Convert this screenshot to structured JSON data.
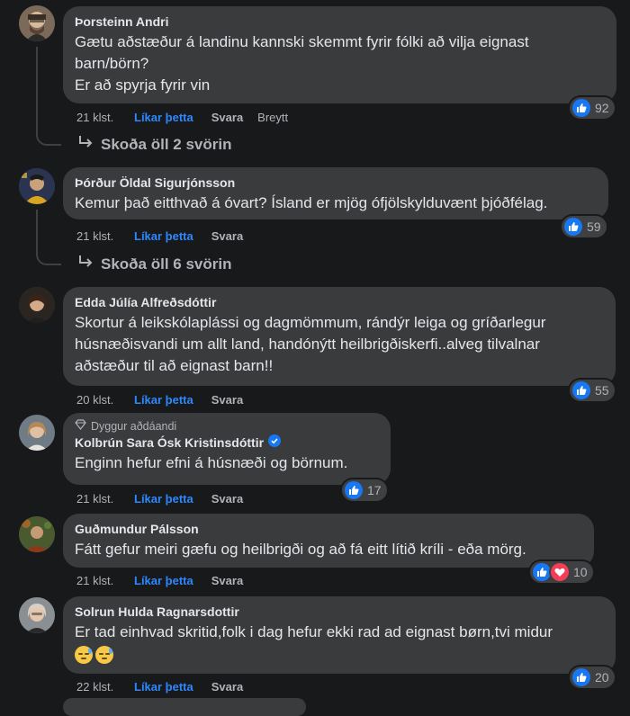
{
  "comments": [
    {
      "author": "Þorsteinn Andri",
      "text": "Gætu aðstæður á landinu kannski skemmt fyrir fólki að vilja eignast barn/börn?\nEr að spyrja fyrir vin",
      "time": "21 klst.",
      "like_label": "Líkar þetta",
      "reply_label": "Svara",
      "edited_label": "Breytt",
      "reaction_count": "92",
      "view_replies": "Skoða öll 2 svörin"
    },
    {
      "author": "Þórður Öldal Sigurjónsson",
      "text": "Kemur það eitthvað á óvart? Ísland er mjög ófjölskylduvænt þjóðfélag.",
      "time": "21 klst.",
      "like_label": "Líkar þetta",
      "reply_label": "Svara",
      "reaction_count": "59",
      "view_replies": "Skoða öll 6 svörin"
    },
    {
      "author": "Edda Júlía Alfreðsdóttir",
      "text": "Skortur á leikskólaplássi og dagmömmum, rándýr leiga og gríðarlegur húsnæðisvandi um allt land, handónýtt heilbrigðiskerfi..alveg tilvalnar aðstæður til að eignast barn!!",
      "time": "20 klst.",
      "like_label": "Líkar þetta",
      "reply_label": "Svara",
      "reaction_count": "55"
    },
    {
      "badge": "Dyggur aðdáandi",
      "author": "Kolbrún Sara Ósk Kristinsdóttir",
      "text": "Enginn hefur efni á húsnæði og börnum.",
      "time": "21 klst.",
      "like_label": "Líkar þetta",
      "reply_label": "Svara",
      "reaction_count": "17"
    },
    {
      "author": "Guðmundur Pálsson",
      "text": "Fátt gefur meiri gæfu og heilbrigði og að fá eitt lítið kríli - eða mörg.",
      "time": "21 klst.",
      "like_label": "Líkar þetta",
      "reply_label": "Svara",
      "reaction_count": "10"
    },
    {
      "author": "Solrun Hulda Ragnarsdottir",
      "text": "Er tad einhvad skritid,folk i dag hefur ekki rad ad eignast børn,tvi midur",
      "time": "22 klst.",
      "like_label": "Líkar þetta",
      "reply_label": "Svara",
      "reaction_count": "20"
    }
  ],
  "icons": {
    "like": "like-thumb-icon",
    "love": "heart-icon",
    "reply_arrow": "reply-arrow-icon",
    "verified": "verified-check-icon",
    "fan_badge": "diamond-icon",
    "emoji": "sad-relieved-face-emoji"
  },
  "colors": {
    "background": "#18191a",
    "bubble": "#3a3b3c",
    "link_blue": "#2d88ff",
    "like_blue": "#1877f2",
    "love_red": "#f33e58"
  }
}
